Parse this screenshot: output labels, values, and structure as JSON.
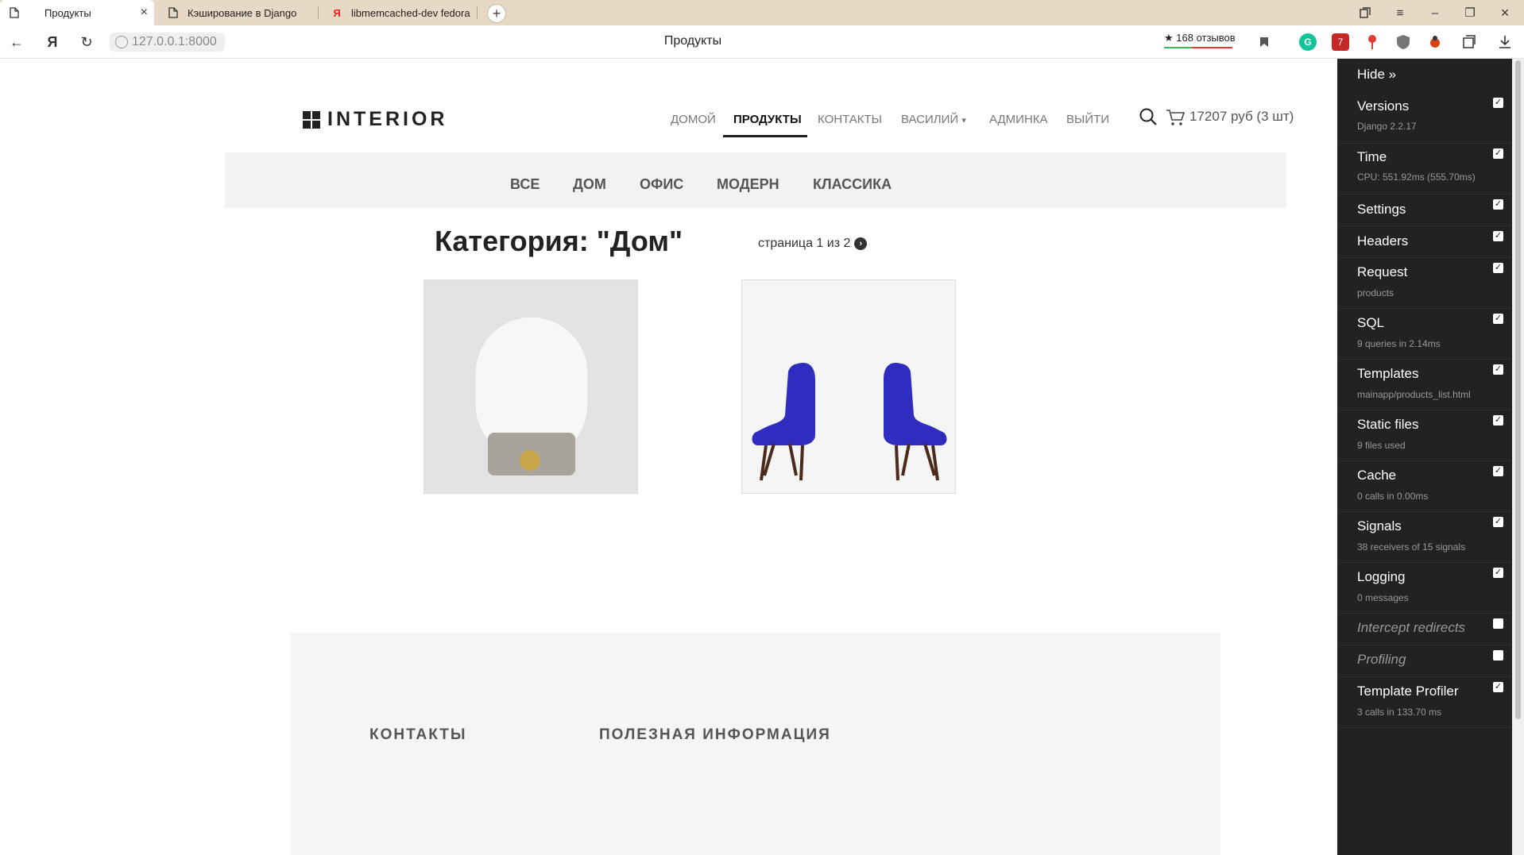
{
  "browser": {
    "tabs": [
      {
        "title": "Продукты",
        "active": true
      },
      {
        "title": "Кэширование в Django",
        "active": false
      },
      {
        "title": "libmemcached-dev fedora",
        "active": false
      }
    ],
    "url": "127.0.0.1:8000",
    "page_title": "Продукты",
    "reviews_badge": "★ 168 отзывов",
    "back_icon": "←",
    "yandex_icon": "Я",
    "reload_icon": "↻",
    "new_tab_icon": "+",
    "close_tab_icon": "×",
    "window_controls": {
      "minimize": "–",
      "restore": "❐",
      "menu": "≡"
    },
    "extension_badge": "7"
  },
  "site": {
    "logo": "INTERIOR",
    "nav": [
      {
        "label": "ДОМОЙ"
      },
      {
        "label": "ПРОДУКТЫ",
        "active": true
      },
      {
        "label": "КОНТАКТЫ"
      },
      {
        "label": "ВАСИЛИЙ"
      },
      {
        "label": "АДМИНКА"
      },
      {
        "label": "ВЫЙТИ"
      }
    ],
    "user_caret": "▾",
    "cart": "17207 руб (3 шт)",
    "categories": [
      "ВСЕ",
      "ДОМ",
      "ОФИС",
      "МОДЕРН",
      "КЛАССИКА"
    ],
    "heading": "Категория: \"Дом\"",
    "pager": "страница 1 из 2",
    "pager_next_icon": "›",
    "footer": {
      "contacts": "КОНТАКТЫ",
      "info": "ПОЛЕЗНАЯ ИНФОРМАЦИЯ"
    }
  },
  "debug_toolbar": {
    "hide": "Hide »",
    "check_mark": "✓",
    "panels": [
      {
        "title": "Versions",
        "subtitle": "Django 2.2.17",
        "checked": true
      },
      {
        "title": "Time",
        "subtitle": "CPU: 551.92ms (555.70ms)",
        "checked": true
      },
      {
        "title": "Settings",
        "subtitle": "",
        "checked": true
      },
      {
        "title": "Headers",
        "subtitle": "",
        "checked": true
      },
      {
        "title": "Request",
        "subtitle": "products",
        "checked": true
      },
      {
        "title": "SQL",
        "subtitle": "9 queries in 2.14ms",
        "checked": true
      },
      {
        "title": "Templates",
        "subtitle": "mainapp/products_list.html",
        "checked": true
      },
      {
        "title": "Static files",
        "subtitle": "9 files used",
        "checked": true
      },
      {
        "title": "Cache",
        "subtitle": "0 calls in 0.00ms",
        "checked": true
      },
      {
        "title": "Signals",
        "subtitle": "38 receivers of 15 signals",
        "checked": true
      },
      {
        "title": "Logging",
        "subtitle": "0 messages",
        "checked": true
      },
      {
        "title": "Intercept redirects",
        "subtitle": "",
        "checked": false
      },
      {
        "title": "Profiling",
        "subtitle": "",
        "checked": false
      },
      {
        "title": "Template Profiler",
        "subtitle": "3 calls in 133.70 ms",
        "checked": true
      }
    ]
  }
}
